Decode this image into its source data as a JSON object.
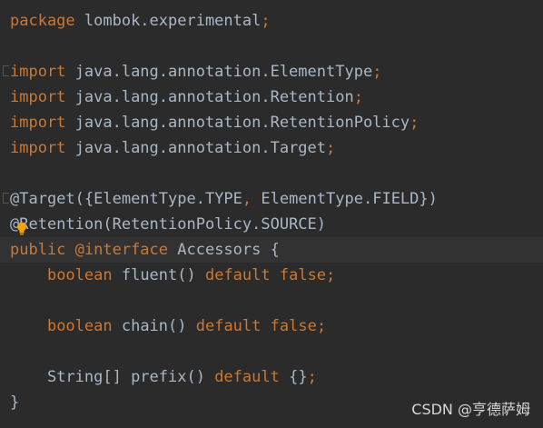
{
  "code": {
    "line1": {
      "kw": "package",
      "rest": " lombok.experimental",
      "semi": ";"
    },
    "line3": {
      "kw": "import",
      "rest": " java.lang.annotation.ElementType",
      "semi": ";"
    },
    "line4": {
      "kw": "import",
      "rest": " java.lang.annotation.Retention",
      "semi": ";"
    },
    "line5": {
      "kw": "import",
      "rest": " java.lang.annotation.RetentionPolicy",
      "semi": ";"
    },
    "line6": {
      "kw": "import",
      "rest": " java.lang.annotation.Target",
      "semi": ";"
    },
    "line8": {
      "ann": "@Target",
      "a": "({ElementType.",
      "b": "TYPE",
      "comma": ",",
      "c": " ElementType.",
      "d": "FIELD",
      "e": "})"
    },
    "line9": {
      "ann": "@Retention",
      "a": "(RetentionPolicy.",
      "b": "SOURCE",
      "c": ")"
    },
    "line10": {
      "kw": "public",
      "ann": " @interface",
      "rest": " Accessors {"
    },
    "line11": {
      "indent": "    ",
      "type": "boolean",
      "rest": " fluent() ",
      "kw": "default",
      "val": " false",
      "semi": ";"
    },
    "line13": {
      "indent": "    ",
      "type": "boolean",
      "rest": " chain() ",
      "kw": "default",
      "val": " false",
      "semi": ";"
    },
    "line15": {
      "indent": "    ",
      "rest": "String[] prefix() ",
      "kw": "default",
      "rest2": " {}",
      "semi": ";"
    },
    "line16": {
      "rest": "}"
    }
  },
  "watermark": "CSDN @亨德萨姆",
  "colors": {
    "background": "#2b2b2b",
    "keyword": "#cc7832",
    "text": "#a9b7c6",
    "annotation": "#bbb529"
  },
  "icons": {
    "bulb": "lightbulb-icon"
  }
}
